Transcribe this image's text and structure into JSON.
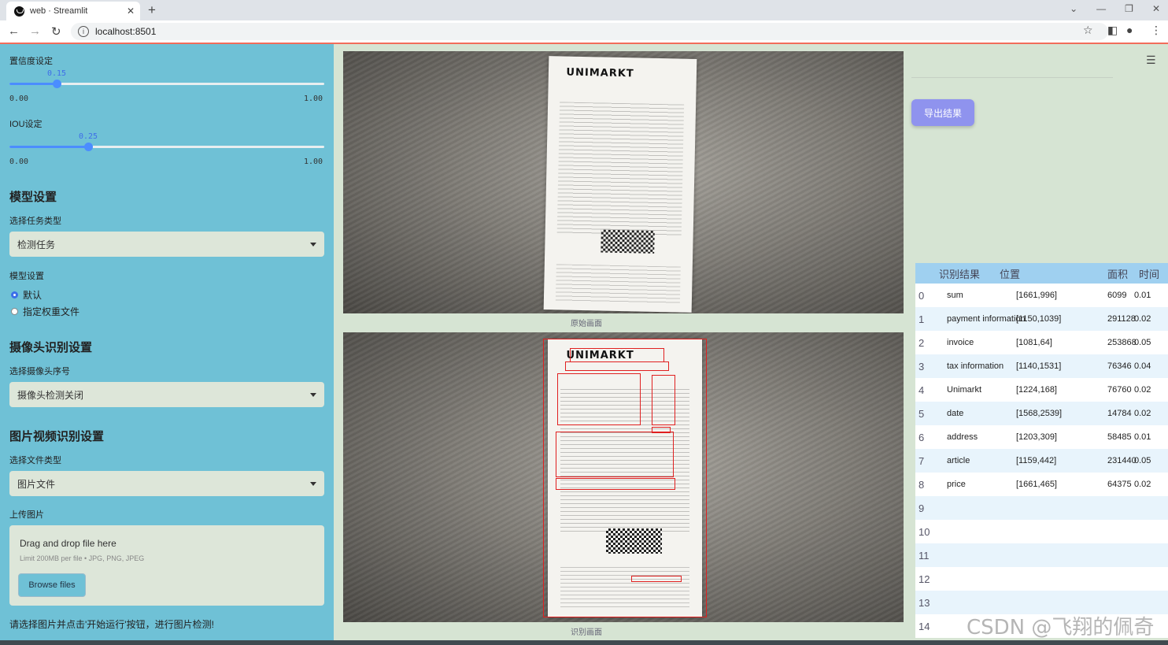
{
  "browser": {
    "tab_title": "web · Streamlit",
    "tab_close": "✕",
    "new_tab": "+",
    "url": "localhost:8501",
    "win_buttons": [
      "⌄",
      "—",
      "❐",
      "✕"
    ]
  },
  "sidebar": {
    "confidence": {
      "label": "置信度设定",
      "value": "0.15",
      "level": 0.15,
      "min": "0.00",
      "max": "1.00"
    },
    "iou": {
      "label": "IOU设定",
      "value": "0.25",
      "level": 0.25,
      "min": "0.00",
      "max": "1.00"
    },
    "model_section": "模型设置",
    "task_type_label": "选择任务类型",
    "task_type_value": "检测任务",
    "model_setting_label": "模型设置",
    "radio_default": "默认",
    "radio_custom": "指定权重文件",
    "camera_section": "摄像头识别设置",
    "camera_label": "选择摄像头序号",
    "camera_value": "摄像头检测关闭",
    "media_section": "图片视频识别设置",
    "file_type_label": "选择文件类型",
    "file_type_value": "图片文件",
    "upload_label": "上传图片",
    "drag_text": "Drag and drop file here",
    "limit_text": "Limit 200MB per file • JPG, PNG, JPEG",
    "browse_button": "Browse files",
    "hint": "请选择图片并点击'开始运行'按钮，进行图片检测!"
  },
  "main": {
    "original_caption": "原始画面",
    "result_caption": "识别画面",
    "receipt_logo": "UNIMARKT"
  },
  "right": {
    "export_button": "导出结果",
    "table": {
      "headers": [
        "识别结果",
        "位置",
        "面积",
        "时间"
      ],
      "rows": [
        {
          "idx": "0",
          "label": "sum",
          "pos": "[1661,996]",
          "area": "6099",
          "time": "0.01"
        },
        {
          "idx": "1",
          "label": "payment information",
          "pos": "[1150,1039]",
          "area": "291128",
          "time": "0.02"
        },
        {
          "idx": "2",
          "label": "invoice",
          "pos": "[1081,64]",
          "area": "253868",
          "time": "0.05"
        },
        {
          "idx": "3",
          "label": "tax information",
          "pos": "[1140,1531]",
          "area": "76346",
          "time": "0.04"
        },
        {
          "idx": "4",
          "label": "Unimarkt",
          "pos": "[1224,168]",
          "area": "76760",
          "time": "0.02"
        },
        {
          "idx": "5",
          "label": "date",
          "pos": "[1568,2539]",
          "area": "14784",
          "time": "0.02"
        },
        {
          "idx": "6",
          "label": "address",
          "pos": "[1203,309]",
          "area": "58485",
          "time": "0.01"
        },
        {
          "idx": "7",
          "label": "article",
          "pos": "[1159,442]",
          "area": "231440",
          "time": "0.05"
        },
        {
          "idx": "8",
          "label": "price",
          "pos": "[1661,465]",
          "area": "64375",
          "time": "0.02"
        },
        {
          "idx": "9",
          "label": "",
          "pos": "",
          "area": "",
          "time": ""
        },
        {
          "idx": "10",
          "label": "",
          "pos": "",
          "area": "",
          "time": ""
        },
        {
          "idx": "11",
          "label": "",
          "pos": "",
          "area": "",
          "time": ""
        },
        {
          "idx": "12",
          "label": "",
          "pos": "",
          "area": "",
          "time": ""
        },
        {
          "idx": "13",
          "label": "",
          "pos": "",
          "area": "",
          "time": ""
        },
        {
          "idx": "14",
          "label": "",
          "pos": "",
          "area": "",
          "time": ""
        }
      ]
    },
    "watermark": "CSDN @飞翔的佩奇"
  }
}
